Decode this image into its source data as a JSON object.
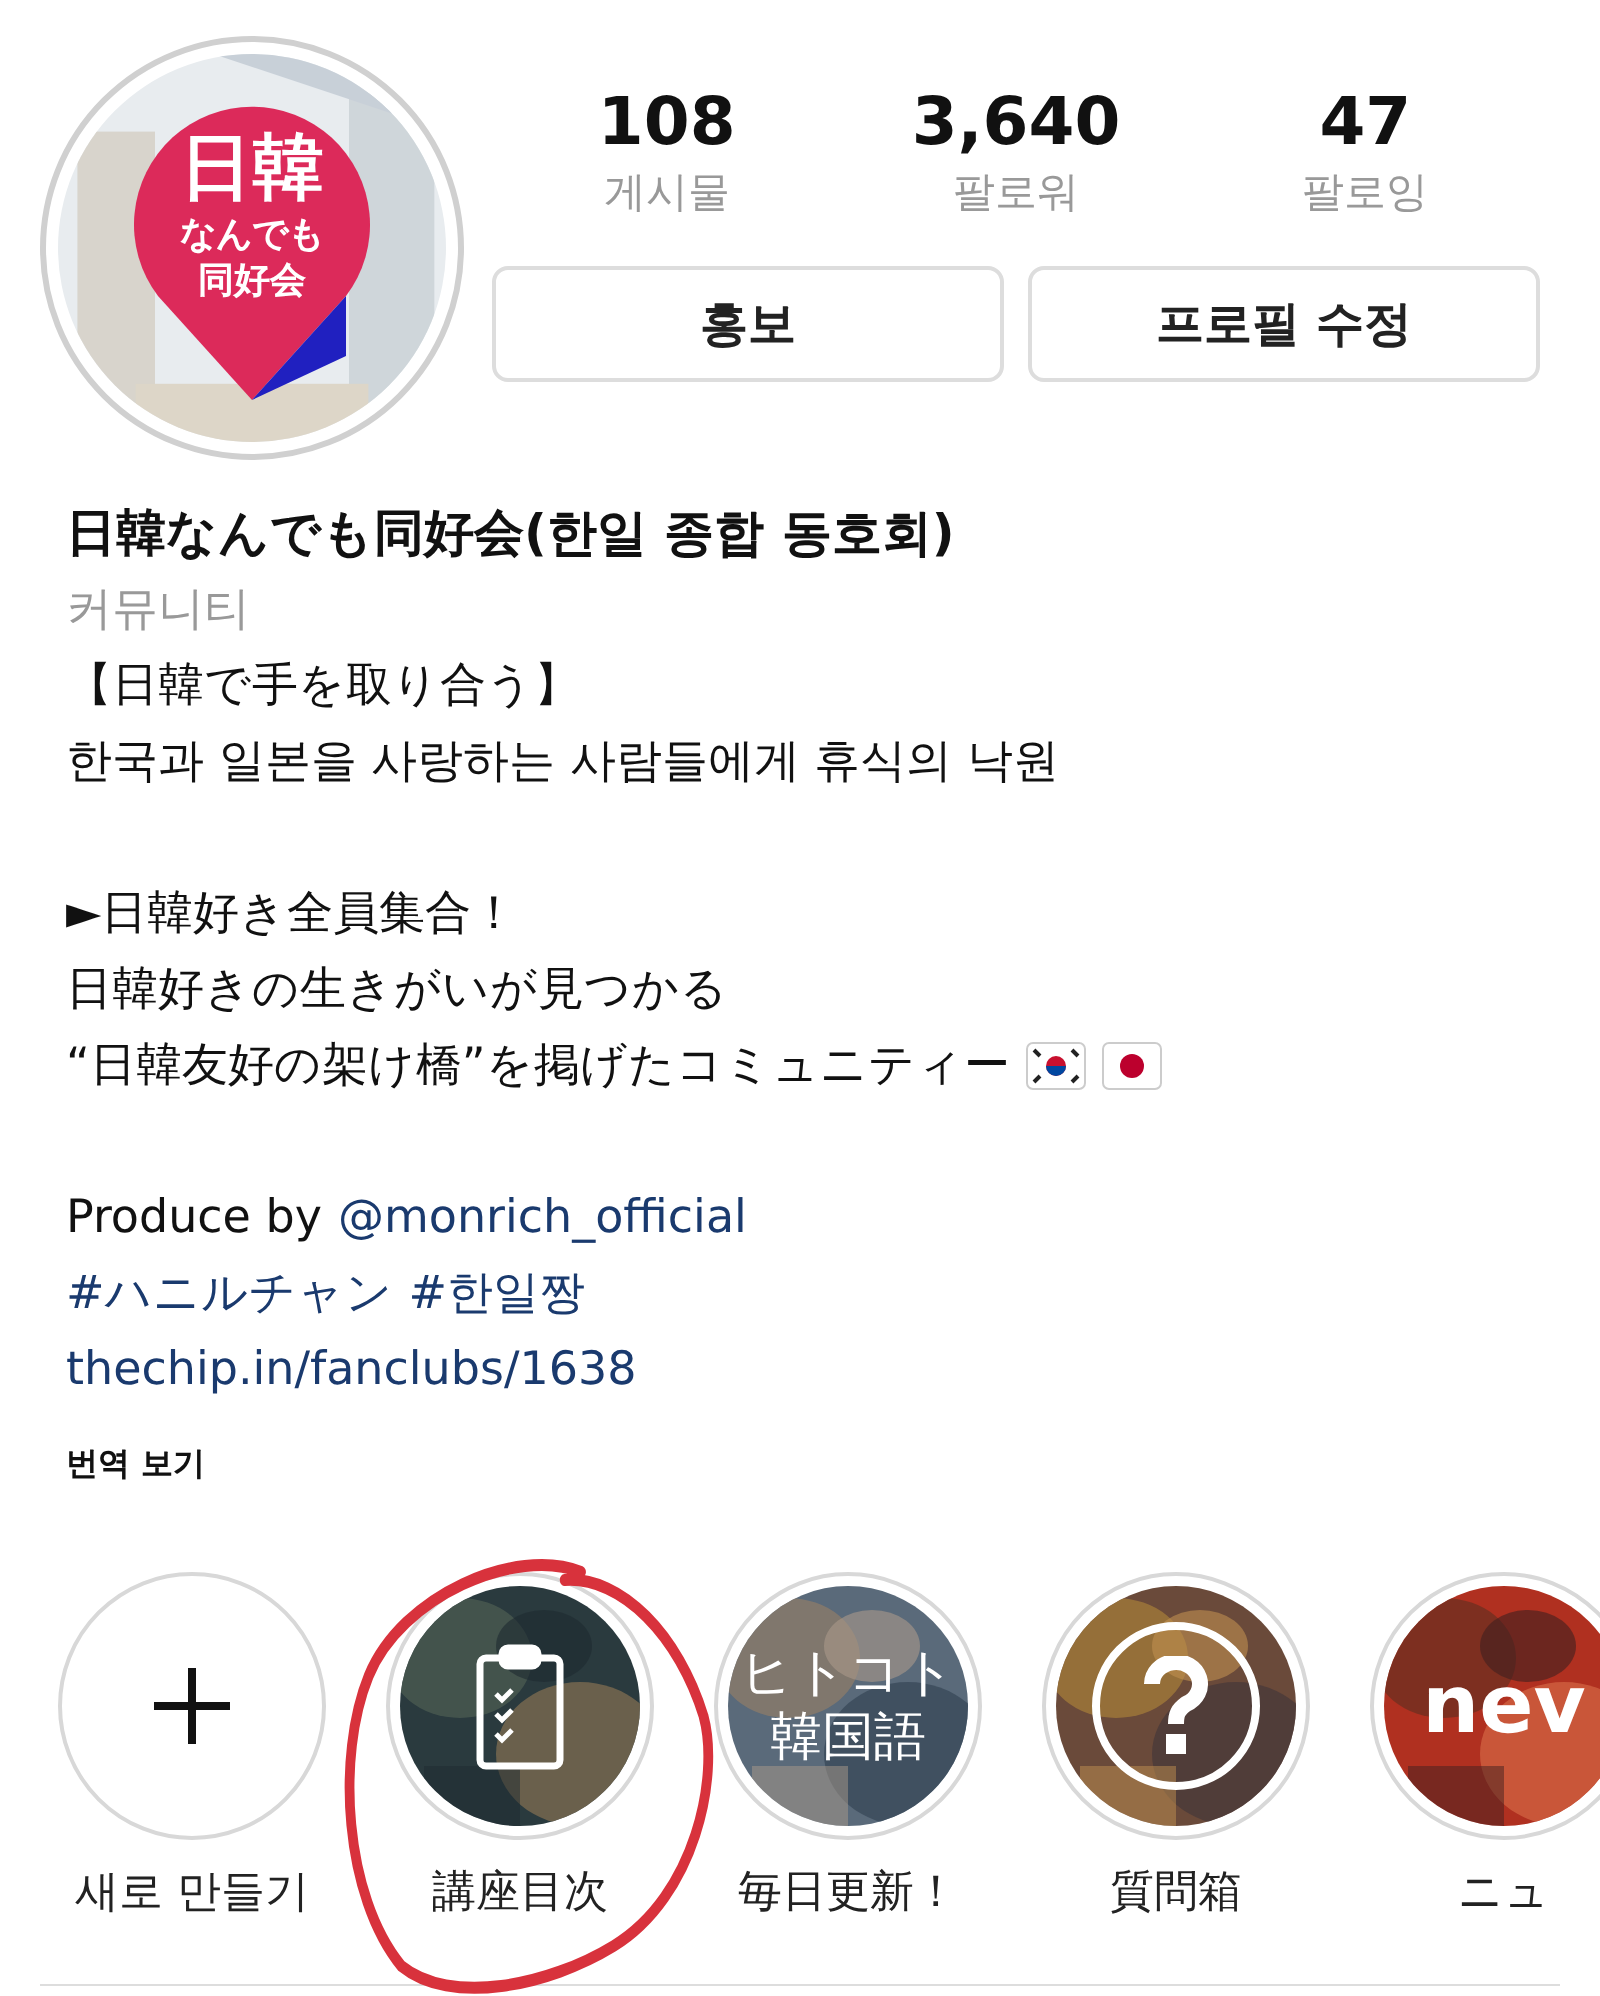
{
  "profile": {
    "logo_lines": [
      "日韓",
      "なんでも",
      "同好会"
    ]
  },
  "stats": [
    {
      "value": "108",
      "label": "게시물"
    },
    {
      "value": "3,640",
      "label": "팔로워"
    },
    {
      "value": "47",
      "label": "팔로잉"
    }
  ],
  "buttons": [
    "홍보",
    "프로필 수정"
  ],
  "name": "日韓なんでも同好会(한일 종합 동호회)",
  "category": "커뮤니티",
  "bio": [
    {
      "kind": "text",
      "parts": [
        {
          "text": "【日韓で手を取り合う】",
          "link": false
        }
      ]
    },
    {
      "kind": "text",
      "parts": [
        {
          "text": "한국과 일본을 사랑하는 사람들에게 휴식의 낙원",
          "link": false
        }
      ]
    },
    {
      "kind": "blank"
    },
    {
      "kind": "text",
      "parts": [
        {
          "text": "►日韓好き全員集合！",
          "link": false
        }
      ]
    },
    {
      "kind": "text",
      "parts": [
        {
          "text": "日韓好きの生きがいが見つかる",
          "link": false
        }
      ]
    },
    {
      "kind": "flags",
      "parts": [
        {
          "text": "“日韓友好の架け橋”を掲げたコミュニティー",
          "link": false
        }
      ]
    },
    {
      "kind": "blank"
    },
    {
      "kind": "text",
      "parts": [
        {
          "text": "Produce by",
          "link": false
        },
        {
          "text": "@monrich_official",
          "link": true
        }
      ]
    },
    {
      "kind": "text",
      "parts": [
        {
          "text": "#ハニルチャン",
          "link": true
        },
        {
          "text": "#한일짱",
          "link": true
        }
      ]
    },
    {
      "kind": "text",
      "parts": [
        {
          "text": "thechip.in/fanclubs/1638",
          "link": true
        }
      ]
    }
  ],
  "translate": "번역 보기",
  "highlights": [
    {
      "kind": "new",
      "label": "새로 만들기"
    },
    {
      "kind": "checklist",
      "label": "講座目次"
    },
    {
      "kind": "text",
      "cover_text": [
        "ヒトコト",
        "韓国語"
      ],
      "label": "毎日更新！"
    },
    {
      "kind": "question",
      "label": "質問箱"
    },
    {
      "kind": "text",
      "cover_text": [
        "nev"
      ],
      "label": "ニュ"
    }
  ]
}
